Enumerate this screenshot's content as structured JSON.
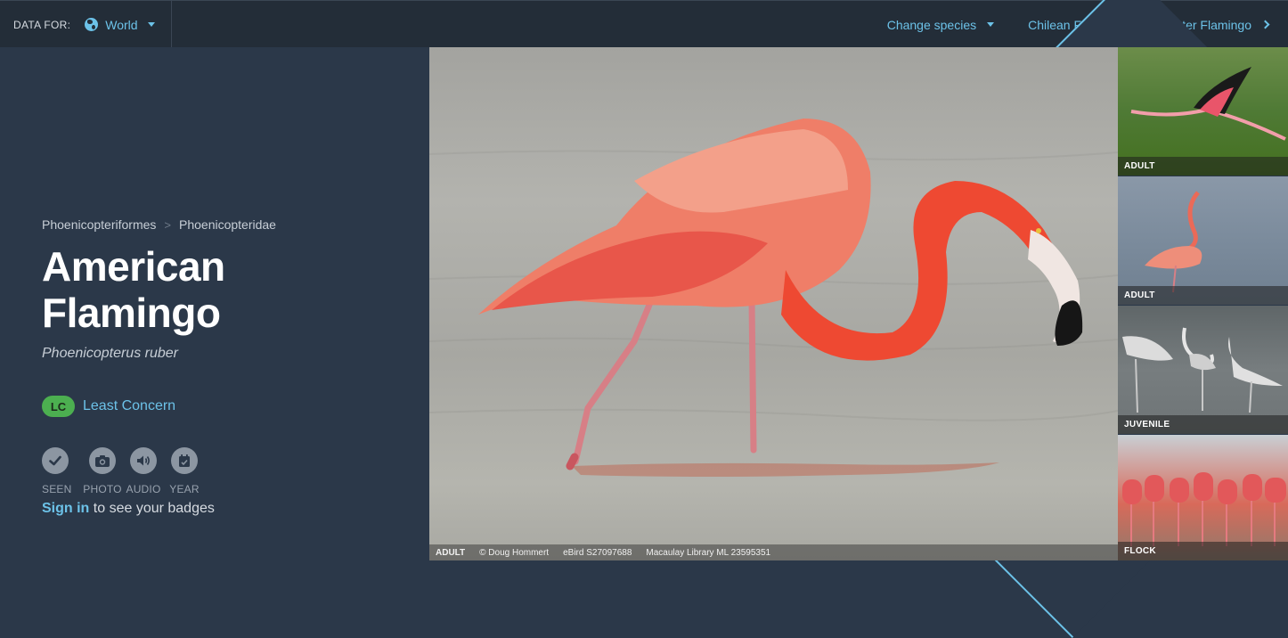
{
  "topbar": {
    "data_for_label": "DATA FOR:",
    "region": "World",
    "change_species": "Change species",
    "prev_species": "Chilean Flamingo",
    "next_species": "Greater Flamingo"
  },
  "species": {
    "order": "Phoenicopteriformes",
    "family": "Phoenicopteridae",
    "breadcrumb_sep": ">",
    "common_name": "American Flamingo",
    "scientific_name": "Phoenicopterus ruber",
    "status_code": "LC",
    "status_text": "Least Concern"
  },
  "badges": [
    {
      "icon": "check-icon",
      "label": "SEEN"
    },
    {
      "icon": "camera-icon",
      "label": "PHOTO"
    },
    {
      "icon": "speaker-icon",
      "label": "AUDIO"
    },
    {
      "icon": "calendar-icon",
      "label": "YEAR"
    }
  ],
  "signin": {
    "link": "Sign in",
    "rest": "to see your badges"
  },
  "main_photo": {
    "age": "ADULT",
    "credit": "© Doug Hommert",
    "ebird": "eBird S27097688",
    "macaulay": "Macaulay Library ML 23595351"
  },
  "thumbnails": [
    {
      "label": "ADULT"
    },
    {
      "label": "ADULT"
    },
    {
      "label": "JUVENILE"
    },
    {
      "label": "FLOCK"
    }
  ],
  "colors": {
    "accent": "#6cc2e8",
    "panel": "#2b3849",
    "topbar": "#232d38",
    "lc_badge": "#4caf50"
  }
}
